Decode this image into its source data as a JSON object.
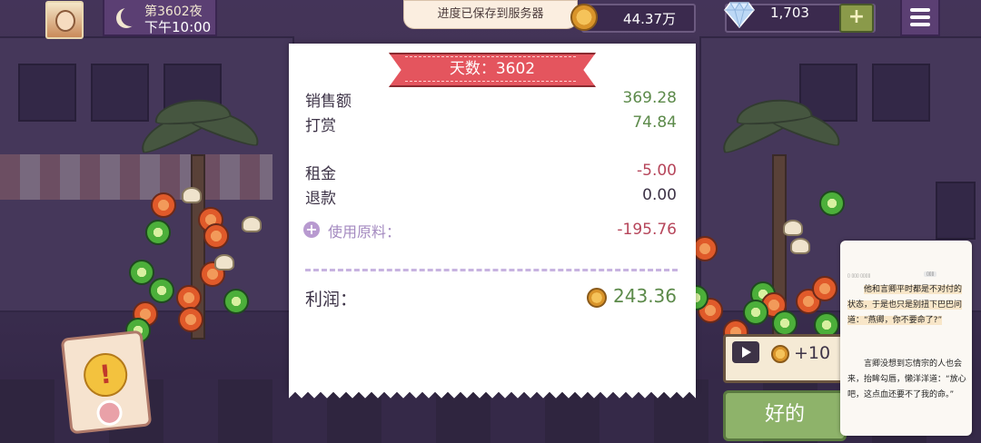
{
  "header": {
    "night_label": "第3602夜",
    "time": "下午10:00",
    "toast": "进度已保存到服务器",
    "money": "44.37万",
    "gems": "1,703",
    "plus": "+",
    "icons": [
      "avatar",
      "moon-icon",
      "coin-icon",
      "diamond-icon",
      "plus-icon",
      "menu-icon"
    ]
  },
  "receipt": {
    "day_title": "天数：3602",
    "rows": [
      {
        "label": "销售额",
        "value": "369.28"
      },
      {
        "label": "打赏",
        "value": "74.84"
      },
      {
        "label": "租金",
        "value": "-5.00"
      },
      {
        "label": "退款",
        "value": "0.00"
      }
    ],
    "ingredients_label": "使用原料：",
    "ingredients_value": "-195.76",
    "profit_label": "利润：",
    "profit_value": "243.36"
  },
  "actions": {
    "ad_reward": "+10",
    "ok": "好的"
  },
  "book": {
    "para1": "他和言卿平时都是不对付的状态，于是也只是别扭下巴巴问道：“燕卿，你不要命了?”",
    "para2": "言卿没想到忘情宗的人也会来，抬眸勾唇，懒洋洋道：“放心吧，这点血还要不了我的命。”"
  },
  "colors": {
    "positive": "#5c8a4a",
    "negative": "#b6455a",
    "ribbon": "#e4555e",
    "ok_button": "#8eb36a"
  }
}
